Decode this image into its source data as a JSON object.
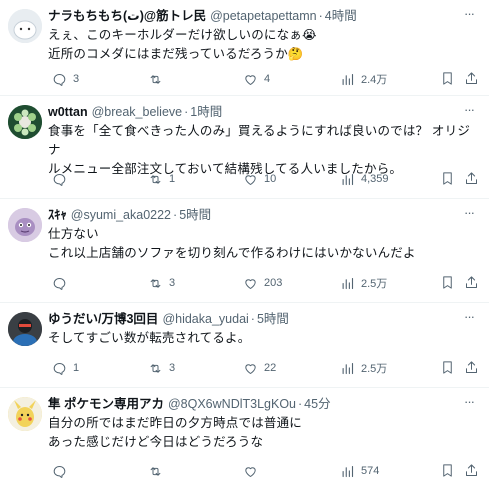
{
  "tweets": [
    {
      "name": "ナラもちもち(ت)@筋トレ民",
      "handle": "@petapetapettamn",
      "time": "4時間",
      "lines": [
        "えぇ、このキーホルダーだけ欲しいのになぁ😭",
        "近所のコメダにはまだ残っているだろうか🤔"
      ],
      "replies": "3",
      "reposts": "",
      "likes": "4",
      "views": "2.4万",
      "avatar_color": "#dfe5ea"
    },
    {
      "name": "w0ttan",
      "handle": "@break_believe",
      "time": "1時間",
      "lines": [
        "食事を「全て食べきった人のみ」買えるようにすれば良いのでは？ オリジナ",
        "ルメニュー全部注文しておいて結構残してる人いましたから。"
      ],
      "replies": "",
      "reposts": "1",
      "likes": "10",
      "views": "4,359",
      "avatar_color": "#2f6b45"
    },
    {
      "name": "ｽｷｬ",
      "handle": "@syumi_aka0222",
      "time": "5時間",
      "lines": [
        "仕方ない",
        "これ以上店舗のソファを切り刻んで作るわけにはいかないんだよ"
      ],
      "replies": "",
      "reposts": "3",
      "likes": "203",
      "views": "2.5万",
      "avatar_color": "#c9b8d8"
    },
    {
      "name": "ゆうだい/万博3回目",
      "handle": "@hidaka_yudai",
      "time": "5時間",
      "lines": [
        "そしてすごい数が転売されてるよ。"
      ],
      "replies": "1",
      "reposts": "3",
      "likes": "22",
      "views": "2.5万",
      "avatar_color": "#2a2a2a"
    },
    {
      "name": "隼 ポケモン専用アカ",
      "handle": "@8QX6wNDlT3LgKOu",
      "time": "45分",
      "lines": [
        "自分の所ではまだ昨日の夕方時点では普通に",
        "あった感じだけど今日はどうだろうな"
      ],
      "replies": "",
      "reposts": "",
      "likes": "",
      "views": "574",
      "avatar_color": "#f2d35a"
    }
  ],
  "more_symbol": "···"
}
